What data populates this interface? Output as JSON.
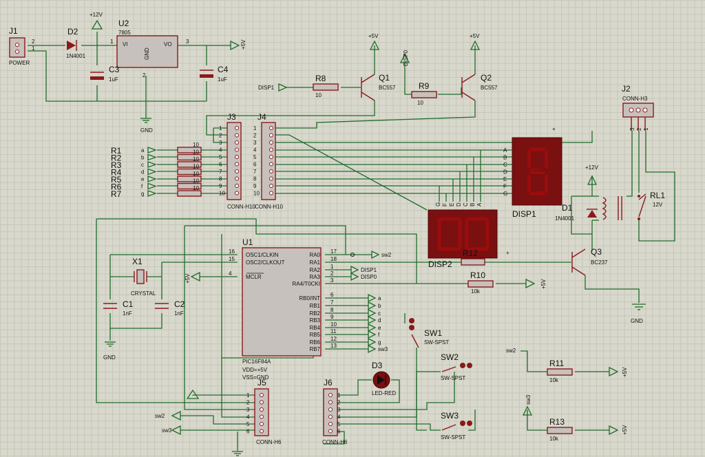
{
  "parts": {
    "J1": {
      "ref": "J1",
      "value": "POWER",
      "pins": [
        "2",
        "1"
      ]
    },
    "D2": {
      "ref": "D2",
      "value": "1N4001"
    },
    "U2": {
      "ref": "U2",
      "value": "7805",
      "vi": "VI",
      "vo": "VO",
      "gnd": "GND",
      "pin1": "1",
      "pin2": "2",
      "pin3": "3"
    },
    "C3": {
      "ref": "C3",
      "value": "1uF"
    },
    "C4": {
      "ref": "C4",
      "value": "1uF"
    },
    "R8": {
      "ref": "R8",
      "value": "10"
    },
    "R9": {
      "ref": "R9",
      "value": "10"
    },
    "Q1": {
      "ref": "Q1",
      "value": "BC557"
    },
    "Q2": {
      "ref": "Q2",
      "value": "BC557"
    },
    "J2": {
      "ref": "J2",
      "value": "CONN-H3",
      "pins": [
        "3",
        "2",
        "1"
      ]
    },
    "J3": {
      "ref": "J3",
      "value": "CONN-H10"
    },
    "J4": {
      "ref": "J4",
      "value": "CONN-H10"
    },
    "RL1": {
      "ref": "RL1",
      "value": "12V"
    },
    "D1": {
      "ref": "D1",
      "value": "1N4001"
    },
    "Q3": {
      "ref": "Q3",
      "value": "BC237"
    },
    "DISP1": {
      "ref": "DISP1"
    },
    "DISP2": {
      "ref": "DISP2"
    },
    "R12": {
      "ref": "R12"
    },
    "R10": {
      "ref": "R10",
      "value": "10k"
    },
    "R11": {
      "ref": "R11",
      "value": "10k"
    },
    "R13": {
      "ref": "R13",
      "value": "10k"
    },
    "X1": {
      "ref": "X1",
      "value": "CRYSTAL"
    },
    "C1": {
      "ref": "C1",
      "value": "1nF"
    },
    "C2": {
      "ref": "C2",
      "value": "1nF"
    },
    "U1": {
      "ref": "U1",
      "value": "PIC16F84A",
      "vdd": "VDD=+5V",
      "vss": "VSS=GND"
    },
    "SW1": {
      "ref": "SW1",
      "value": "SW-SPST"
    },
    "SW2": {
      "ref": "SW2",
      "value": "SW-SPST"
    },
    "SW3": {
      "ref": "SW3",
      "value": "SW-SPST"
    },
    "D3": {
      "ref": "D3",
      "value": "LED-RED"
    },
    "J5": {
      "ref": "J5",
      "value": "CONN-H6"
    },
    "J6": {
      "ref": "J6",
      "value": "CONN-H6"
    }
  },
  "resistors_r1_r7": {
    "refs": [
      "R1",
      "R2",
      "R3",
      "R4",
      "R5",
      "R6",
      "R7"
    ],
    "nets": [
      "a",
      "b",
      "c",
      "d",
      "e",
      "f",
      "g"
    ],
    "value": "10"
  },
  "header_pins_10": [
    "1",
    "2",
    "3",
    "4",
    "5",
    "6",
    "7",
    "8",
    "9",
    "10"
  ],
  "header_pins_6": [
    "1",
    "2",
    "3",
    "4",
    "5",
    "6"
  ],
  "display_segments": [
    "A",
    "B",
    "C",
    "D",
    "E",
    "F",
    "G"
  ],
  "display2_pins": [
    "G",
    "F",
    "E",
    "D",
    "C",
    "B",
    "A"
  ],
  "u1_left_pins": [
    {
      "num": "16",
      "name": "OSC1/CLKIN"
    },
    {
      "num": "15",
      "name": "OSC2/CLKOUT"
    },
    {
      "num": "4",
      "name": "MCLR"
    }
  ],
  "u1_right_pins": [
    {
      "num": "17",
      "name": "RA0"
    },
    {
      "num": "18",
      "name": "RA1"
    },
    {
      "num": "1",
      "name": "RA2"
    },
    {
      "num": "2",
      "name": "RA3"
    },
    {
      "num": "3",
      "name": "RA4/T0CKI"
    },
    {
      "num": "6",
      "name": "RB0/INT"
    },
    {
      "num": "7",
      "name": "RB1"
    },
    {
      "num": "8",
      "name": "RB2"
    },
    {
      "num": "9",
      "name": "RB3"
    },
    {
      "num": "10",
      "name": "RB4"
    },
    {
      "num": "11",
      "name": "RB5"
    },
    {
      "num": "12",
      "name": "RB6"
    },
    {
      "num": "13",
      "name": "RB7"
    }
  ],
  "u1_right_nets": [
    "sw2",
    "",
    "DISP1",
    "DISP0",
    "",
    "a",
    "b",
    "c",
    "d",
    "e",
    "f",
    "g",
    "sw3"
  ],
  "power": {
    "vcc12": "+12V",
    "vcc5": "+5V",
    "gnd": "GND"
  },
  "labels": {
    "disp0": "DISP0",
    "disp1": "DISP1",
    "sw2": "sw2",
    "sw3": "sw3"
  },
  "plus": "+"
}
